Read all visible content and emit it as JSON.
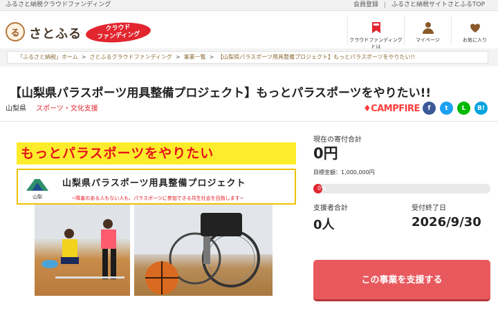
{
  "topbar": {
    "tagline": "ふるさと納税クラウドファンディング",
    "links": [
      "会員登録",
      "ふるさと納税サイトさとふるTOP"
    ]
  },
  "header": {
    "logo_mark": "る",
    "logo_text": "さとふる",
    "badge_line1": "クラウド",
    "badge_line2": "ファンディング",
    "nav": [
      {
        "label": "クラウドファンディングとは",
        "icon": "bookmark-icon"
      },
      {
        "label": "マイページ",
        "icon": "person-icon"
      },
      {
        "label": "お気に入り",
        "icon": "heart-icon"
      }
    ]
  },
  "breadcrumb": [
    "「ふるさと納税」ホーム",
    "さとふるクラウドファンディング",
    "事業一覧",
    "【山梨県パラスポーツ用具整備プロジェクト】もっとパラスポーツをやりたい!!"
  ],
  "project": {
    "title": "【山梨県パラスポーツ用具整備プロジェクト】もっとパラスポーツをやりたい!!",
    "prefecture": "山梨県",
    "category": "スポーツ・文化支援",
    "platform": "CAMPFIRE"
  },
  "social": [
    {
      "name": "facebook-icon",
      "glyph": "f",
      "color": "#3b5998"
    },
    {
      "name": "twitter-icon",
      "glyph": "t",
      "color": "#1da1f2"
    },
    {
      "name": "line-icon",
      "glyph": "L",
      "color": "#00b900"
    },
    {
      "name": "hatena-icon",
      "glyph": "B!",
      "color": "#00a4de"
    }
  ],
  "banner": {
    "headline": "もっとパラスポーツをやりたい",
    "subtitle": "山梨県パラスポーツ用具整備プロジェクト",
    "logo_caption": "山梨",
    "note": "~障害のある人もない人も、パラスポーツに参加できる共生社会を目指します~"
  },
  "funding": {
    "total_label": "現在の寄付合計",
    "total_value": "0円",
    "goal_text": "目標金額：1,000,000円",
    "progress_percent": 0,
    "progress_label": "0%",
    "supporters_label": "支援者合計",
    "supporters_value": "0人",
    "deadline_label": "受付終了日",
    "deadline_value": "2026/9/30",
    "support_button": "この事業を支援する"
  },
  "colors": {
    "accent": "#e2262f",
    "button": "#e8595e",
    "banner_yellow": "#fdec2b"
  }
}
